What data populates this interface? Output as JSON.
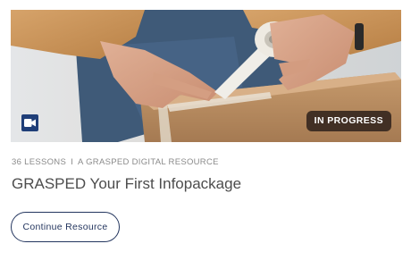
{
  "card": {
    "image_alt": "Hands taping a cardboard box",
    "media_icon": "video-camera-icon",
    "status": "IN PROGRESS",
    "lessons": "36 LESSONS",
    "separator": "I",
    "resource_type": "A GRASPED DIGITAL RESOURCE",
    "title": "GRASPED Your First Infopackage",
    "cta_label": "Continue Resource"
  },
  "colors": {
    "brand_navy": "#24365f",
    "video_badge": "#1f3e78",
    "status_pill": "#372820",
    "meta_text": "#8a8a8a",
    "title_text": "#4d4d4d"
  }
}
